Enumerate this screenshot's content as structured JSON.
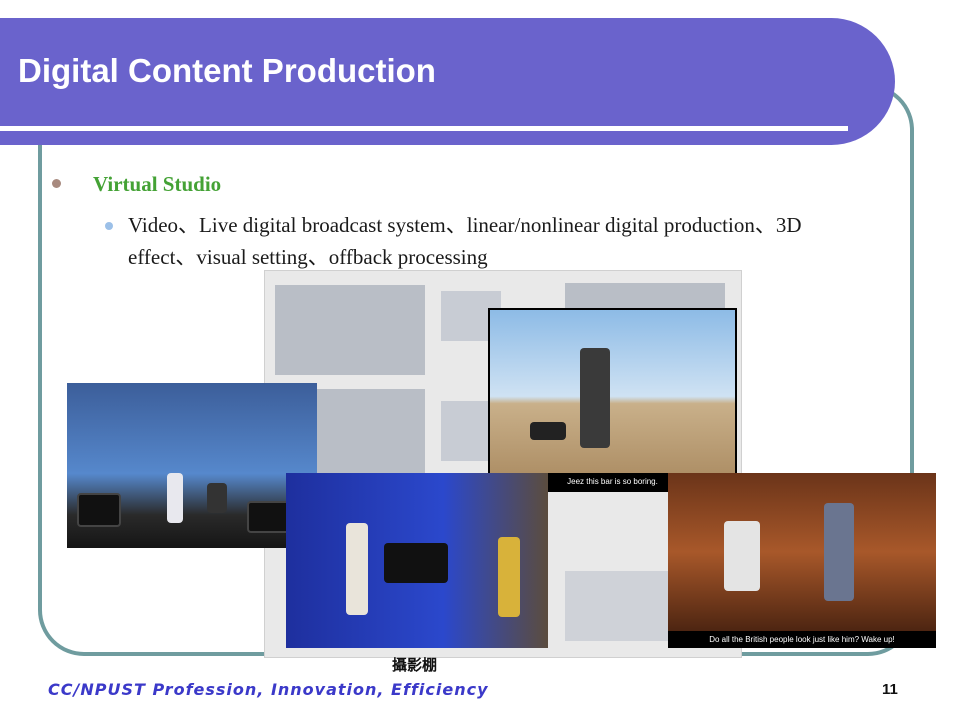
{
  "slide": {
    "title": "Digital Content Production",
    "heading": "Virtual Studio",
    "description": "Video、Live digital broadcast system、linear/nonlinear digital production、3D effect、visual setting、offback processing",
    "figure_caption": "攝影棚",
    "footer": "CC/NPUST Profession, Innovation, Efficiency",
    "page_number": "11"
  },
  "images": {
    "desert_subtitle": "Jeez this bar is so boring.",
    "bar_subtitle": "Do all the British people look just like him? Wake up!"
  },
  "colors": {
    "banner": "#6a63cc",
    "frame": "#6f9c9f",
    "heading": "#44a235",
    "footer": "#3b39c9"
  }
}
